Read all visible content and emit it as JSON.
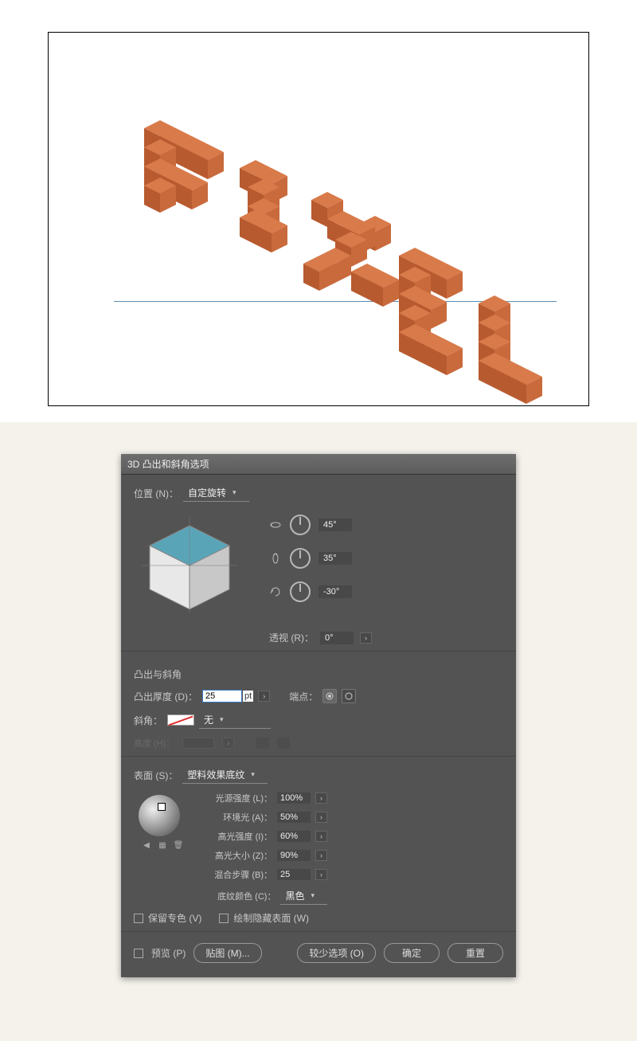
{
  "dialog": {
    "title": "3D 凸出和斜角选项",
    "position_label": "位置 (N)：",
    "position_value": "自定旋转",
    "rotation": {
      "x": "45°",
      "y": "35°",
      "z": "-30°"
    },
    "perspective_label": "透视 (R)：",
    "perspective_value": "0°",
    "extrude_section": "凸出与斜角",
    "depth_label": "凸出厚度 (D)：",
    "depth_value": "25",
    "depth_unit": "pt",
    "cap_label": "端点：",
    "bevel_label": "斜角：",
    "bevel_value": "无",
    "bevel_height_label": "高度 (H)：",
    "surface_label": "表面 (S)：",
    "surface_value": "塑料效果底纹",
    "light_intensity_label": "光源强度 (L)：",
    "light_intensity_value": "100%",
    "ambient_label": "环境光 (A)：",
    "ambient_value": "50%",
    "highlight_intensity_label": "高光强度 (I)：",
    "highlight_intensity_value": "60%",
    "highlight_size_label": "高光大小 (Z)：",
    "highlight_size_value": "90%",
    "blend_steps_label": "混合步骤 (B)：",
    "blend_steps_value": "25",
    "shade_color_label": "底纹颜色 (C)：",
    "shade_color_value": "黑色",
    "preserve_spot_label": "保留专色 (V)",
    "draw_hidden_label": "绘制隐藏表面 (W)",
    "preview_label": "预览 (P)",
    "map_art_btn": "贴图 (M)...",
    "fewer_btn": "较少选项 (O)",
    "ok_btn": "确定",
    "reset_btn": "重置"
  }
}
